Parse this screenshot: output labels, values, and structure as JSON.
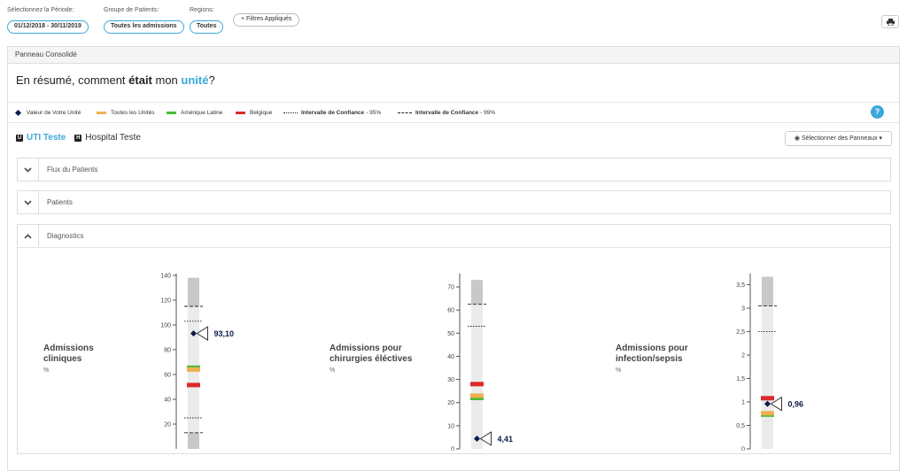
{
  "filters": {
    "period": {
      "label": "Sélectionnez la Période:",
      "value": "01/12/2018 - 30/11/2019"
    },
    "patient_group": {
      "label": "Groupe de Patients:",
      "value": "Toutes les admissions"
    },
    "regions": {
      "label": "Regions:",
      "value": "Toutes"
    },
    "applied_filters_label": "+ Filtres Appliqués",
    "print_icon": "printer-icon"
  },
  "panel": {
    "title": "Panneau Consolidé",
    "headline": {
      "prefix": "En résumé, comment ",
      "bold": "était",
      "middle": " mon ",
      "accent": "unité",
      "suffix": "?"
    }
  },
  "legend": {
    "unit_value": "Valeur de Votre Unité",
    "all_units": "Toutes les Unités",
    "latin_america": "Amérique Latine",
    "belgium": "Belgique",
    "ci95_bold": "Intervalle de Confiance",
    "ci95_suffix": "- 95%",
    "ci99_bold": "Intervalle de Confiance",
    "ci99_suffix": "- 99%",
    "colors": {
      "unit": "#0d1b4c",
      "all_units": "#f0b050",
      "latin_america": "#4cbb3c",
      "belgium": "#dd2a2a"
    }
  },
  "unit_tabs": [
    {
      "badge": "U",
      "label": "UTI Teste",
      "active": true
    },
    {
      "badge": "H",
      "label": "Hospital Teste",
      "active": false
    }
  ],
  "select_panels_label": "Sélectionner des Panneaux ▾",
  "accordions": [
    {
      "title": "Flux du Patients",
      "open": false
    },
    {
      "title": "Patients",
      "open": false
    },
    {
      "title": "Diagnostics",
      "open": true
    }
  ],
  "chart_data": [
    {
      "type": "scatter",
      "title": "Admissions cliniques",
      "unit_label": "%",
      "ylim": [
        0,
        140
      ],
      "yticks": [
        20,
        40,
        60,
        80,
        100,
        120,
        140
      ],
      "unit_value": 93.1,
      "unit_value_label": "93,10",
      "all_units": 64,
      "latin_america": 65.5,
      "belgium": 51.5,
      "ci95": [
        25,
        103
      ],
      "ci99": [
        13,
        115
      ],
      "range_top": 138
    },
    {
      "type": "scatter",
      "title": "Admissions pour chirurgies éléctives",
      "unit_label": "%",
      "ylim": [
        0,
        75
      ],
      "yticks": [
        0,
        10,
        20,
        30,
        40,
        50,
        60,
        70
      ],
      "unit_value": 4.41,
      "unit_value_label": "4,41",
      "all_units": 23,
      "latin_america": 22,
      "belgium": 28,
      "ci95": [
        0,
        53
      ],
      "ci99": [
        0,
        62.5
      ],
      "range_top": 73
    },
    {
      "type": "scatter",
      "title": "Admissions pour infection/sepsis",
      "unit_label": "%",
      "ylim": [
        0,
        3.7
      ],
      "yticks": [
        0,
        0.5,
        1,
        1.5,
        2,
        2.5,
        3,
        3.5
      ],
      "ytick_labels": [
        "0",
        "0,5",
        "1",
        "1,5",
        "2",
        "2,5",
        "3",
        "3,5"
      ],
      "unit_value": 0.96,
      "unit_value_label": "0,96",
      "all_units": 0.76,
      "latin_america": 0.73,
      "belgium": 1.08,
      "ci95": [
        0,
        2.5
      ],
      "ci99": [
        0,
        3.05
      ],
      "range_top": 3.67
    }
  ]
}
